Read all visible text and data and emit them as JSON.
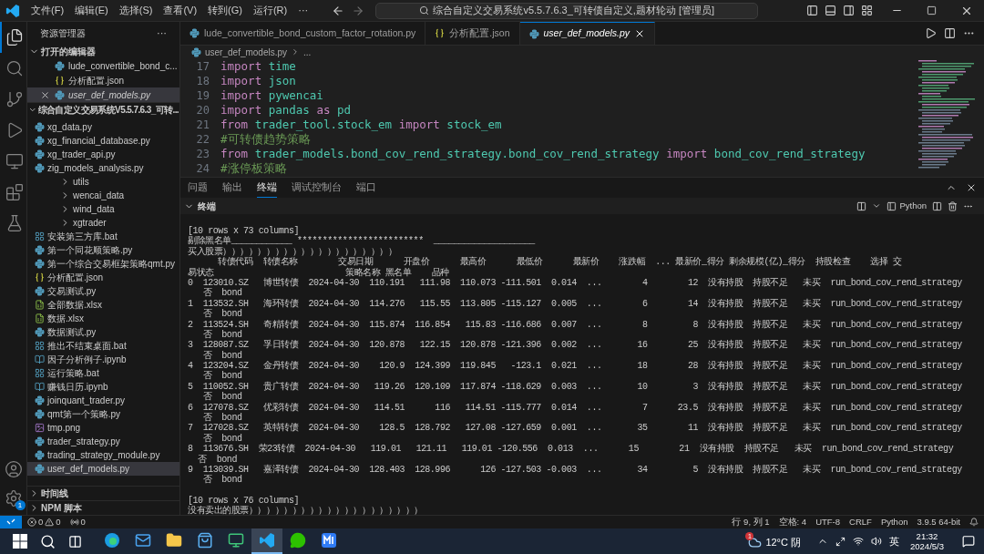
{
  "title_bar": {
    "menus": [
      "文件(F)",
      "编辑(E)",
      "选择(S)",
      "查看(V)",
      "转到(G)",
      "运行(R)",
      "···"
    ],
    "command_center": "综合自定义交易系统v5.5.7.6.3_可转债自定义,题材轮动 [管理员]"
  },
  "activity_bar": [
    {
      "kind": "files",
      "selected": true
    },
    {
      "kind": "search",
      "selected": false
    },
    {
      "kind": "git",
      "selected": false
    },
    {
      "kind": "debug",
      "selected": false
    },
    {
      "kind": "remote",
      "selected": false
    },
    {
      "kind": "extensions",
      "selected": false
    },
    {
      "kind": "testing",
      "selected": false
    }
  ],
  "sidebar": {
    "title": "资源管理器",
    "more": "···",
    "open_editors": {
      "title": "打开的编辑器",
      "expanded": true,
      "items": [
        {
          "name": "lude_convertible_bond_c...",
          "kind": "py",
          "selected": false,
          "italic": false
        },
        {
          "name": "分析配置.json",
          "kind": "json",
          "selected": false,
          "italic": false
        },
        {
          "name": "user_def_models.py",
          "kind": "py",
          "selected": true,
          "italic": true
        }
      ]
    },
    "project": {
      "title": "综合自定义交易系统V5.5.7.6.3_可转...",
      "expanded": true,
      "items": [
        {
          "name": "xg_data.py",
          "kind": "py",
          "selected": false
        },
        {
          "name": "xg_financial_database.py",
          "kind": "py",
          "selected": false
        },
        {
          "name": "xg_trader_api.py",
          "kind": "py",
          "selected": false
        },
        {
          "name": "zig_models_analysis.py",
          "kind": "py",
          "selected": false
        },
        {
          "name": "utils",
          "kind": "folder",
          "selected": false
        },
        {
          "name": "wencai_data",
          "kind": "folder",
          "selected": false
        },
        {
          "name": "wind_data",
          "kind": "folder",
          "selected": false
        },
        {
          "name": "xgtrader",
          "kind": "folder",
          "selected": false
        },
        {
          "name": "安装第三方库.bat",
          "kind": "bat",
          "selected": false
        },
        {
          "name": "第一个同花顺策略.py",
          "kind": "py",
          "selected": false
        },
        {
          "name": "第一个综合交易框架策略qmt.py",
          "kind": "py",
          "selected": false
        },
        {
          "name": "分析配置.json",
          "kind": "json",
          "selected": false
        },
        {
          "name": "交易测试.py",
          "kind": "py",
          "selected": false
        },
        {
          "name": "全部数据.xlsx",
          "kind": "xlsx",
          "selected": false
        },
        {
          "name": "数据.xlsx",
          "kind": "xlsx",
          "selected": false
        },
        {
          "name": "数据测试.py",
          "kind": "py",
          "selected": false
        },
        {
          "name": "推出不结束桌面.bat",
          "kind": "bat",
          "selected": false
        },
        {
          "name": "因子分析例子.ipynb",
          "kind": "ipynb",
          "selected": false
        },
        {
          "name": "运行策略.bat",
          "kind": "bat",
          "selected": false
        },
        {
          "name": "赚钱日历.ipynb",
          "kind": "ipynb",
          "selected": false
        },
        {
          "name": "joinquant_trader.py",
          "kind": "py",
          "selected": false
        },
        {
          "name": "qmt第一个策略.py",
          "kind": "py",
          "selected": false
        },
        {
          "name": "tmp.png",
          "kind": "png",
          "selected": false
        },
        {
          "name": "trader_strategy.py",
          "kind": "py",
          "selected": false
        },
        {
          "name": "trading_strategy_module.py",
          "kind": "py",
          "selected": false
        },
        {
          "name": "user_def_models.py",
          "kind": "py",
          "selected": true
        }
      ]
    },
    "sections": [
      {
        "title": "时间线",
        "expanded": false
      },
      {
        "title": "NPM 脚本",
        "expanded": false
      }
    ]
  },
  "settings_badge": "1",
  "tabs": [
    {
      "label": "lude_convertible_bond_custom_factor_rotation.py",
      "kind": "py",
      "selected": false
    },
    {
      "label": "分析配置.json",
      "kind": "json",
      "selected": false
    },
    {
      "label": "user_def_models.py",
      "kind": "py",
      "selected": true
    }
  ],
  "breadcrumb": [
    "user_def_models.py",
    "..."
  ],
  "code": [
    {
      "n": "17",
      "tokens": [
        {
          "t": "import",
          "kind": "keyword"
        },
        {
          "t": " time",
          "kind": "module"
        }
      ]
    },
    {
      "n": "18",
      "tokens": [
        {
          "t": "import",
          "kind": "keyword"
        },
        {
          "t": " json",
          "kind": "module"
        }
      ]
    },
    {
      "n": "19",
      "tokens": [
        {
          "t": "import",
          "kind": "keyword"
        },
        {
          "t": " pywencai",
          "kind": "module"
        }
      ]
    },
    {
      "n": "20",
      "tokens": [
        {
          "t": "import",
          "kind": "keyword"
        },
        {
          "t": " pandas ",
          "kind": "module"
        },
        {
          "t": "as",
          "kind": "keyword"
        },
        {
          "t": " pd",
          "kind": "module"
        }
      ]
    },
    {
      "n": "21",
      "tokens": [
        {
          "t": "from",
          "kind": "keyword"
        },
        {
          "t": " trader_tool.stock_em ",
          "kind": "module"
        },
        {
          "t": "import",
          "kind": "keyword"
        },
        {
          "t": " stock_em",
          "kind": "module"
        }
      ]
    },
    {
      "n": "22",
      "tokens": [
        {
          "t": "#可转债趋势策略",
          "kind": "comment"
        }
      ]
    },
    {
      "n": "23",
      "tokens": [
        {
          "t": "from",
          "kind": "keyword"
        },
        {
          "t": " trader_models.bond_cov_rend_strategy.bond_cov_rend_strategy ",
          "kind": "module"
        },
        {
          "t": "import",
          "kind": "keyword"
        },
        {
          "t": " bond_cov_rend_strategy",
          "kind": "module"
        }
      ]
    },
    {
      "n": "24",
      "tokens": [
        {
          "t": "#涨停板策略",
          "kind": "comment"
        }
      ]
    }
  ],
  "panel": {
    "tabs": [
      {
        "label": "问题",
        "selected": false
      },
      {
        "label": "输出",
        "selected": false
      },
      {
        "label": "终端",
        "selected": true
      },
      {
        "label": "调试控制台",
        "selected": false
      },
      {
        "label": "端口",
        "selected": false
      }
    ],
    "terminal_title": "终端",
    "shell": "Python",
    "blocks": [
      [
        "[10 rows x 73 columns]",
        "剔除黑名单____________ *************************  ____________________",
        "买入股票））））））））））））））））））））",
        "      转债代码  转债名称        交易日期      开盘价      最高价      最低价      最新价    涨跌幅  ... 最新价_得分 剩余规模(亿)_得分  持股检查    选择 交",
        "易状态                          策略名称 黑名单    品种",
        "0  123010.SZ   博世转债  2024-04-30  110.191   111.98  110.073 -111.501  0.014  ...        4        12  没有持股  持股不足   未买  run_bond_cov_rend_strategy",
        "   否  bond",
        "1  113532.SH   海环转债  2024-04-30  114.276   115.55  113.805 -115.127  0.005  ...        6        14  没有持股  持股不足   未买  run_bond_cov_rend_strategy",
        "   否  bond",
        "2  113524.SH   奇精转债  2024-04-30  115.874  116.854   115.83 -116.686  0.007  ...        8         8  没有持股  持股不足   未买  run_bond_cov_rend_strategy",
        "   否  bond",
        "3  128087.SZ   孚日转债  2024-04-30  120.878   122.15  120.878 -121.396  0.002  ...       16        25  没有持股  持股不足   未买  run_bond_cov_rend_strategy",
        "   否  bond",
        "4  123204.SZ   金丹转债  2024-04-30    120.9  124.399  119.845   -123.1  0.021  ...       18        28  没有持股  持股不足   未买  run_bond_cov_rend_strategy",
        "   否  bond",
        "5  110052.SH   贵广转债  2024-04-30   119.26  120.109  117.874 -118.629  0.003  ...       10         3  没有持股  持股不足   未买  run_bond_cov_rend_strategy",
        "   否  bond",
        "6  127078.SZ   优彩转债  2024-04-30   114.51      116   114.51 -115.777  0.014  ...        7      23.5  没有持股  持股不足   未买  run_bond_cov_rend_strategy",
        "   否  bond",
        "7  127028.SZ   英特转债  2024-04-30    128.5  128.792   127.08 -127.659  0.001  ...       35        11  没有持股  持股不足   未买  run_bond_cov_rend_strategy",
        "   否  bond",
        "8  113676.SH  荣23转债  2024-04-30   119.01   121.11   119.01 -120.556  0.013  ...      15        21  没有持股  持股不足   未买  run_bond_cov_rend_strategy",
        "  否  bond",
        "9  113039.SH   嘉泽转债  2024-04-30  128.403  128.996      126 -127.503 -0.003  ...       34         5  没有持股  持股不足   未买  run_bond_cov_rend_strategy",
        "   否  bond"
      ],
      [
        "[10 rows x 76 columns]",
        "没有卖出的股票））））））））））））））））））））"
      ]
    ]
  },
  "status_bar": {
    "problems": "0",
    "warnings": "0",
    "ports": "0",
    "right": [
      "行 9, 列 1",
      "空格: 4",
      "UTF-8",
      "CRLF",
      "Python",
      "3.9.5 64-bit"
    ]
  },
  "taskbar": {
    "apps": [
      {
        "kind": "edge",
        "active": false
      },
      {
        "kind": "mail",
        "active": false
      },
      {
        "kind": "explorer",
        "active": false
      },
      {
        "kind": "store",
        "active": false
      },
      {
        "kind": "remote",
        "active": false
      },
      {
        "kind": "vscode",
        "active": true
      },
      {
        "kind": "wechat",
        "active": false
      },
      {
        "kind": "notes",
        "active": false
      }
    ],
    "weather": "12°C 阴",
    "weather_badge": "1",
    "ime": "英",
    "time": "21:32",
    "date": "2024/5/3"
  }
}
